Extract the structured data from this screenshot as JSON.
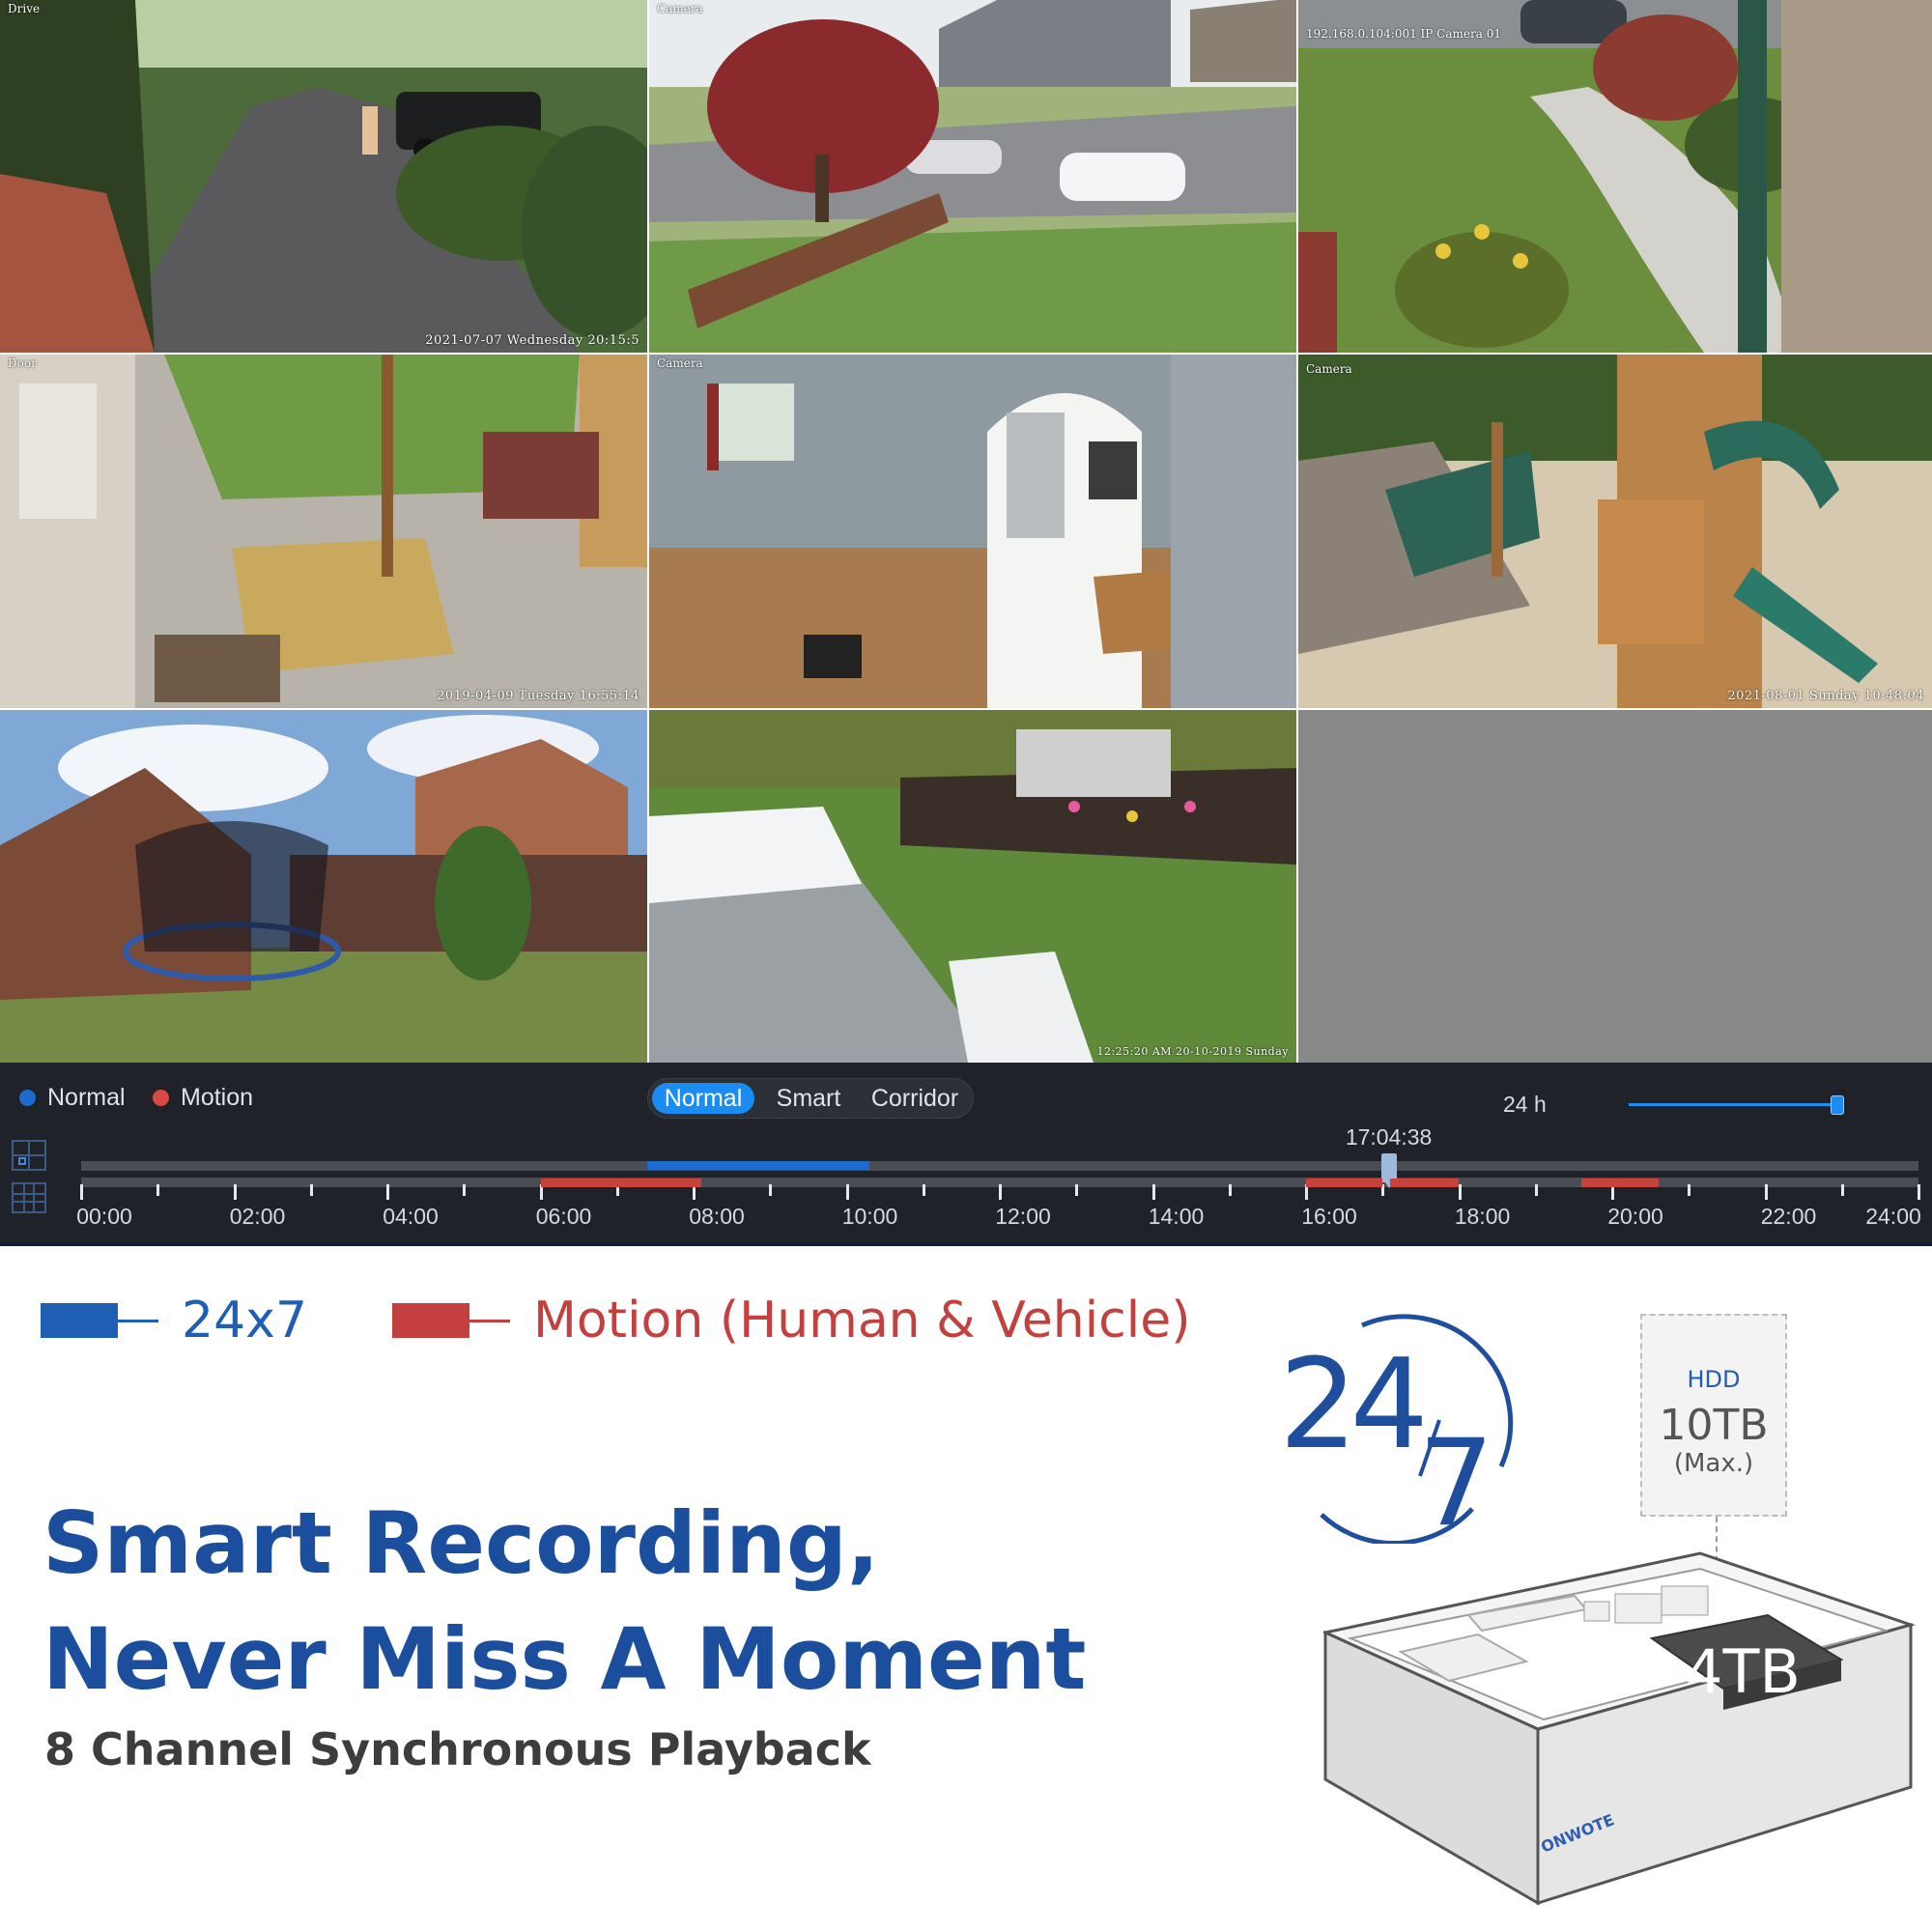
{
  "cameras": [
    {
      "label": "Drive",
      "timestamp": "2021-07-07 Wednesday 20:15:5"
    },
    {
      "label": "Camera",
      "timestamp": ""
    },
    {
      "label": "192.168.0.104:001 IP Camera 01",
      "timestamp": ""
    },
    {
      "label": "Door",
      "timestamp": "2019-04-09 Tuesday 16:55:14"
    },
    {
      "label": "Camera",
      "timestamp": ""
    },
    {
      "label": "Camera",
      "timestamp": "2021-08-01 Sunday 10:48:04"
    },
    {
      "label": "",
      "timestamp": ""
    },
    {
      "label": "",
      "timestamp": "12:25:20 AM 20-10-2019 Sunday"
    }
  ],
  "playback": {
    "legend_normal": "Normal",
    "legend_motion": "Motion",
    "modes": [
      "Normal",
      "Smart",
      "Corridor"
    ],
    "active_mode": "Normal",
    "range_label": "24 h",
    "current_time": "17:04:38",
    "current_hour": 17.08,
    "time_labels": [
      "00:00",
      "02:00",
      "04:00",
      "06:00",
      "08:00",
      "10:00",
      "12:00",
      "14:00",
      "16:00",
      "18:00",
      "20:00",
      "22:00",
      "24:00"
    ],
    "normal_segments_hours": [
      [
        7.4,
        10.3
      ]
    ],
    "motion_segments_hours": [
      [
        6.0,
        8.1
      ],
      [
        16.0,
        17.0
      ],
      [
        17.1,
        18.0
      ],
      [
        19.6,
        20.6
      ]
    ],
    "colors": {
      "normal": "#1f6ad0",
      "motion": "#c8423b",
      "active": "#1b8cf2"
    }
  },
  "key": {
    "normal_label": "24x7",
    "motion_label": "Motion (Human & Vehicle)",
    "normal_color": "#1f5fb3",
    "motion_color": "#c4403f"
  },
  "headline": {
    "line1": "Smart Recording,",
    "line2": "Never Miss A Moment",
    "subline": "8 Channel Synchronous Playback"
  },
  "badge": {
    "big": "24",
    "small": "7"
  },
  "hdd": {
    "label": "HDD",
    "capacity": "10TB",
    "note": "(Max.)",
    "installed": "4TB",
    "brand": "ONWOTE"
  }
}
